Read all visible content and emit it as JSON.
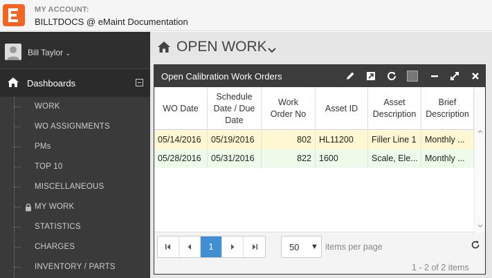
{
  "account": {
    "label": "MY ACCOUNT:",
    "name": "BILLTDOCS @ eMaint Documentation"
  },
  "user": {
    "name": "Bill Taylor"
  },
  "sidebar": {
    "section": "Dashboards",
    "items": [
      {
        "label": "WORK",
        "locked": false
      },
      {
        "label": "WO ASSIGNMENTS",
        "locked": false
      },
      {
        "label": "PMs",
        "locked": false
      },
      {
        "label": "TOP 10",
        "locked": false
      },
      {
        "label": "MISCELLANEOUS",
        "locked": false
      },
      {
        "label": "MY WORK",
        "locked": true
      },
      {
        "label": "STATISTICS",
        "locked": false
      },
      {
        "label": "CHARGES",
        "locked": false
      },
      {
        "label": "INVENTORY / PARTS",
        "locked": false
      }
    ]
  },
  "main": {
    "title": "OPEN WORK"
  },
  "widget": {
    "title": "Open Calibration Work Orders",
    "columns": [
      "WO Date",
      "Schedule Date / Due Date",
      "Work Order No",
      "Asset ID",
      "Asset Description",
      "Brief Description"
    ],
    "rows": [
      {
        "wo_date": "05/14/2016",
        "due": "05/19/2016",
        "wo_no": "802",
        "asset_id": "HL11200",
        "asset_desc": "Filler Line 1",
        "brief": "Monthly ...",
        "color": "#fff7d1"
      },
      {
        "wo_date": "05/28/2016",
        "due": "05/31/2016",
        "wo_no": "822",
        "asset_id": "1600",
        "asset_desc": "Scale, Ele...",
        "brief": "Monthly ...",
        "color": "#eefbea"
      }
    ],
    "pager": {
      "current_page": "1",
      "page_size": "50",
      "items_per_page_label": "items per page",
      "count_text": "1 - 2 of 2 items"
    }
  },
  "colors": {
    "brand": "#f26522",
    "sidebar": "#3a3a3a",
    "header_bar": "#3c3c3c",
    "active_page": "#3f8fd2"
  },
  "icons": [
    "brand-logo-icon",
    "user-icon",
    "home-icon",
    "minus-square-icon",
    "lock-icon",
    "pencil-icon",
    "expand-arrow-icon",
    "refresh-icon",
    "color-swatch-icon",
    "minimize-icon",
    "maximize-icon",
    "close-icon",
    "first-page-icon",
    "prev-page-icon",
    "next-page-icon",
    "last-page-icon"
  ]
}
